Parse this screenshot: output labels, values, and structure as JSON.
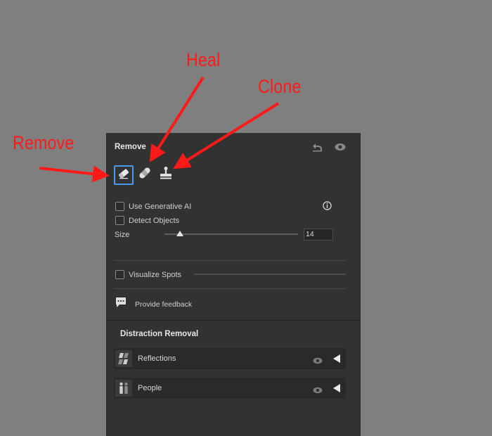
{
  "annotations": {
    "heal": "Heal",
    "clone": "Clone",
    "remove": "Remove"
  },
  "panel": {
    "title": "Remove",
    "header_icons": [
      "undo-icon",
      "eye-icon"
    ],
    "tools": [
      {
        "name": "remove-tool",
        "icon": "eraser-icon",
        "active": true
      },
      {
        "name": "heal-tool",
        "icon": "bandage-icon",
        "active": false
      },
      {
        "name": "clone-tool",
        "icon": "stamp-icon",
        "active": false
      }
    ],
    "use_generative_ai": {
      "label": "Use Generative AI",
      "checked": false
    },
    "detect_objects": {
      "label": "Detect Objects",
      "checked": false
    },
    "size": {
      "label": "Size",
      "value": "14"
    },
    "visualize_spots": {
      "label": "Visualize Spots",
      "checked": false
    },
    "feedback": {
      "label": "Provide feedback"
    }
  },
  "distraction_removal": {
    "title": "Distraction Removal",
    "items": [
      {
        "label": "Reflections",
        "icon": "reflections-icon"
      },
      {
        "label": "People",
        "icon": "people-icon"
      }
    ]
  },
  "colors": {
    "accent": "#4a9bf0",
    "annotation": "#ff1a1a",
    "panel_bg": "#323232",
    "desktop_bg": "#7f7f7f"
  }
}
